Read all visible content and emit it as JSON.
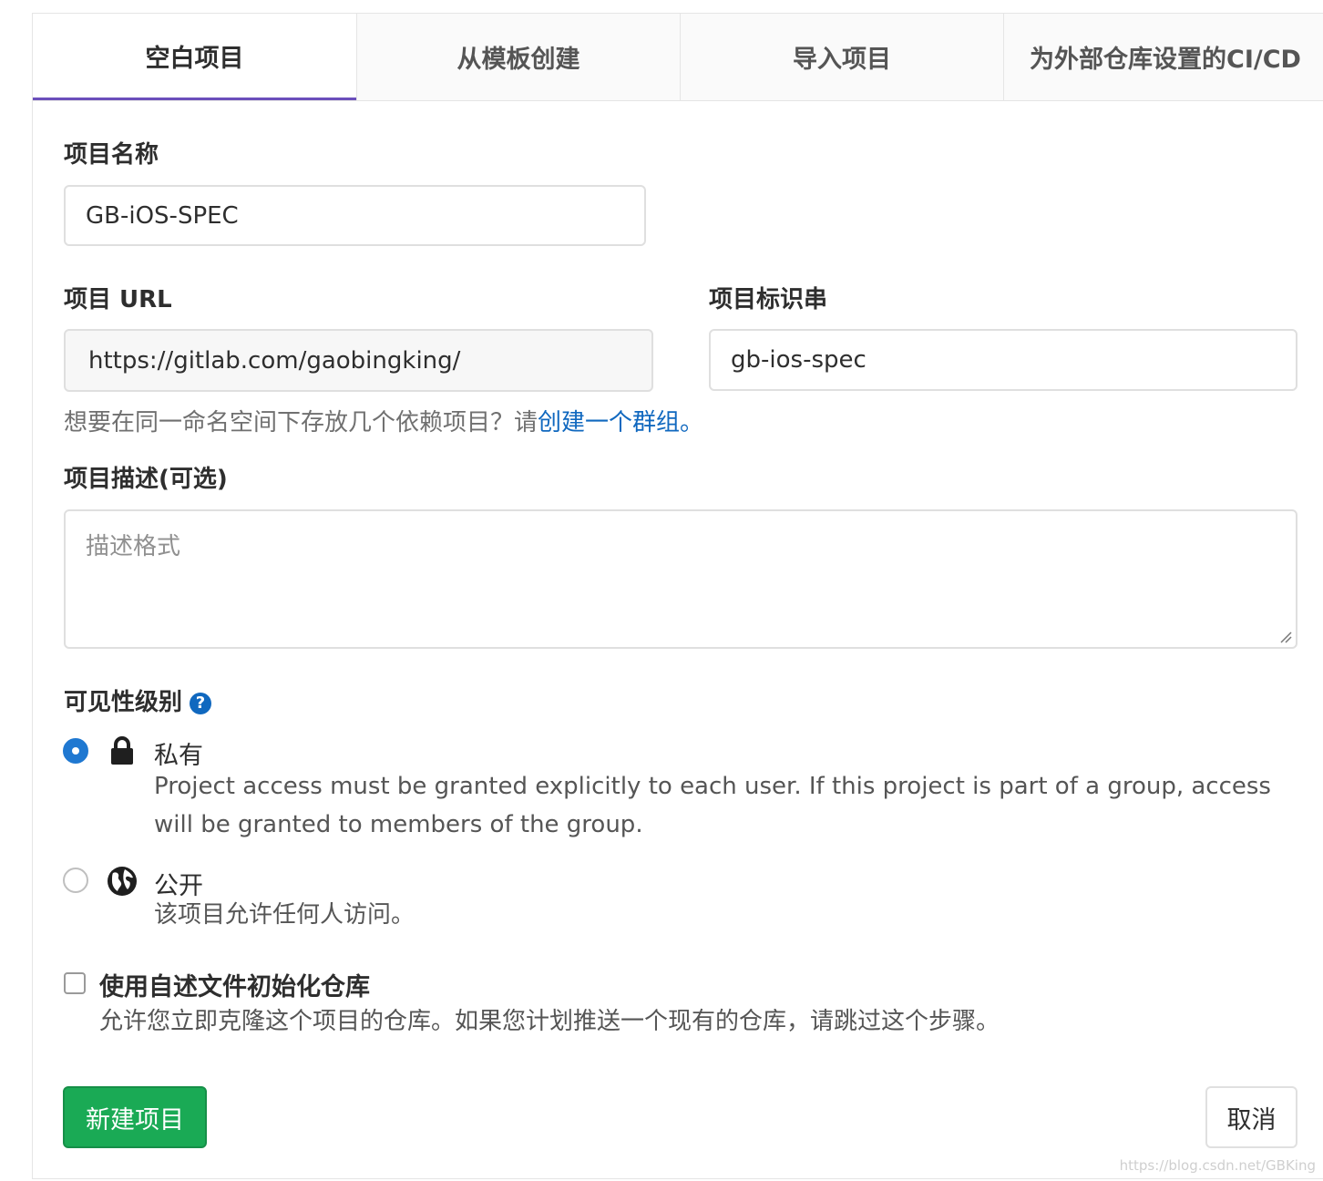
{
  "tabs": [
    {
      "label": "空白项目"
    },
    {
      "label": "从模板创建"
    },
    {
      "label": "导入项目"
    },
    {
      "label": "为外部仓库设置的CI/CD"
    }
  ],
  "project_name": {
    "label": "项目名称",
    "value": "GB-iOS-SPEC"
  },
  "project_url": {
    "label": "项目 URL",
    "value": "https://gitlab.com/gaobingking/"
  },
  "project_slug": {
    "label": "项目标识串",
    "value": "gb-ios-spec"
  },
  "namespace_hint": {
    "text": "想要在同一命名空间下存放几个依赖项目？请",
    "link": "创建一个群组。"
  },
  "description": {
    "label": "项目描述(可选)",
    "placeholder": "描述格式"
  },
  "visibility": {
    "label": "可见性级别",
    "help_icon": "?",
    "options": [
      {
        "title": "私有",
        "icon": "lock-icon",
        "checked": true,
        "description": "Project access must be granted explicitly to each user. If this project is part of a group, access will be granted to members of the group."
      },
      {
        "title": "公开",
        "icon": "globe-icon",
        "checked": false,
        "description": "该项目允许任何人访问。"
      }
    ]
  },
  "readme": {
    "label": "使用自述文件初始化仓库",
    "description": "允许您立即克隆这个项目的仓库。如果您计划推送一个现有的仓库，请跳过这个步骤。",
    "checked": false
  },
  "buttons": {
    "create": "新建项目",
    "cancel": "取消"
  },
  "colors": {
    "accent": "#6b4fbb",
    "link": "#1068bf",
    "primary_button": "#1aaa55",
    "radio_checked": "#1f78d1"
  },
  "watermark": "https://blog.csdn.net/GBKing"
}
